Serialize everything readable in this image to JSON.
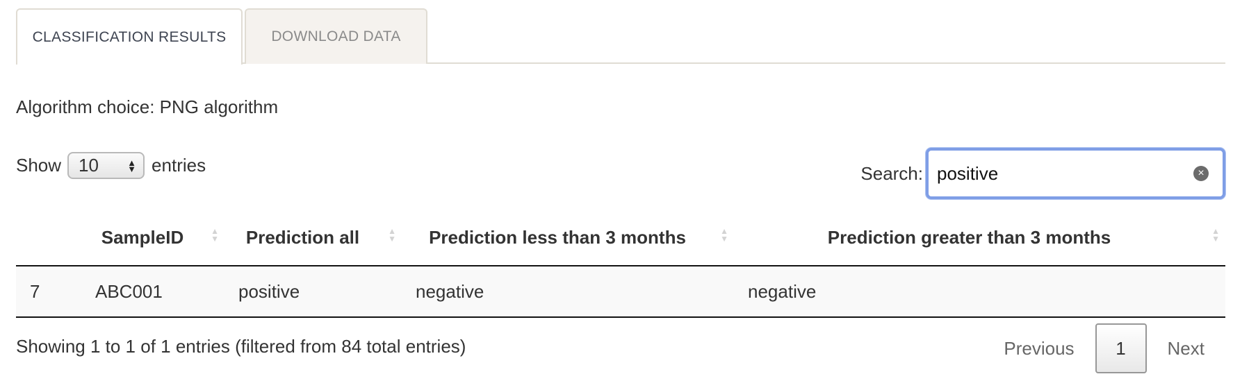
{
  "tabs": [
    {
      "label": "CLASSIFICATION RESULTS",
      "active": true
    },
    {
      "label": "DOWNLOAD DATA",
      "active": false
    }
  ],
  "algorithm_text": "Algorithm choice: PNG algorithm",
  "length_control": {
    "show_label": "Show",
    "selected": "10",
    "entries_label": "entries"
  },
  "search": {
    "label": "Search:",
    "value": "positive"
  },
  "table": {
    "columns": [
      "",
      "SampleID",
      "Prediction all",
      "Prediction less than 3 months",
      "Prediction greater than 3 months"
    ],
    "rows": [
      [
        "7",
        "ABC001",
        "positive",
        "negative",
        "negative"
      ]
    ]
  },
  "info": "Showing 1 to 1 of 1 entries (filtered from 84 total entries)",
  "pagination": {
    "previous": "Previous",
    "current": "1",
    "next": "Next"
  },
  "colors": {
    "search_focus_border": "#7f9ee6",
    "tab_border": "#e0dcd3",
    "inactive_tab_bg": "#f5f2ee",
    "row_bg": "#f9f9f9"
  }
}
